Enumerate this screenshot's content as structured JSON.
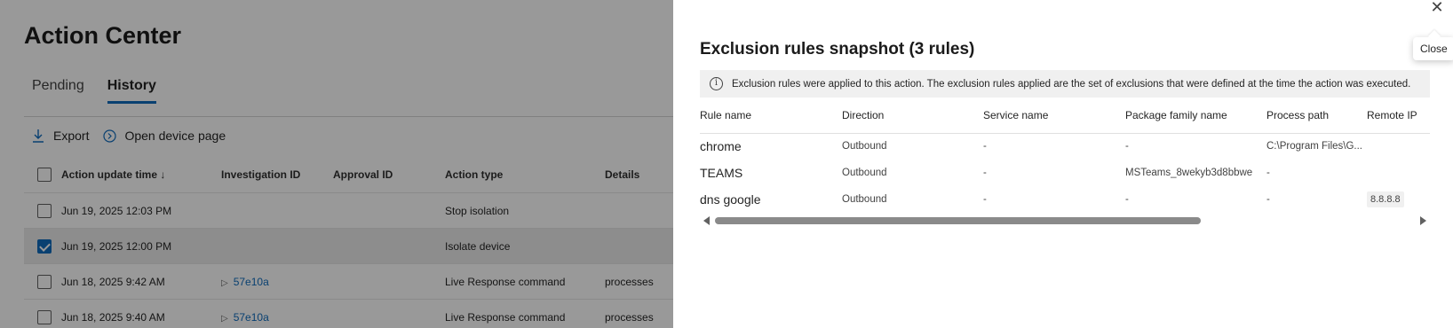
{
  "page": {
    "title": "Action Center",
    "tabs": [
      {
        "label": "Pending"
      },
      {
        "label": "History"
      }
    ],
    "toolbar": {
      "export_label": "Export",
      "open_device_label": "Open device page"
    },
    "grid": {
      "columns": [
        "Action update time ↓",
        "Investigation ID",
        "Approval ID",
        "Action type",
        "Details"
      ],
      "rows": [
        {
          "time": "Jun 19, 2025 12:03 PM",
          "investigation": "",
          "action": "Stop isolation",
          "details": ""
        },
        {
          "time": "Jun 19, 2025 12:00 PM",
          "investigation": "",
          "action": "Isolate device",
          "details": ""
        },
        {
          "time": "Jun 18, 2025 9:42 AM",
          "investigation": "57e10a",
          "action": "Live Response command",
          "details": "processes"
        },
        {
          "time": "Jun 18, 2025 9:40 AM",
          "investigation": "57e10a",
          "action": "Live Response command",
          "details": "processes"
        }
      ]
    }
  },
  "panel": {
    "title": "Exclusion rules snapshot (3 rules)",
    "close_tooltip": "Close",
    "info_text": "Exclusion rules were applied to this action. The exclusion rules applied are the set of exclusions that were defined at the time the action was executed.",
    "columns": [
      "Rule name",
      "Direction",
      "Service name",
      "Package family name",
      "Process path",
      "Remote IP"
    ],
    "rules": [
      {
        "name": "chrome",
        "direction": "Outbound",
        "service": "-",
        "package": "-",
        "path": "C:\\Program Files\\G...",
        "remote_ip": ""
      },
      {
        "name": "TEAMS",
        "direction": "Outbound",
        "service": "-",
        "package": "MSTeams_8wekyb3d8bbwe",
        "path": "-",
        "remote_ip": ""
      },
      {
        "name": "dns google",
        "direction": "Outbound",
        "service": "-",
        "package": "-",
        "path": "-",
        "remote_ip": "8.8.8.8"
      }
    ]
  },
  "icons": {
    "export": "download-icon",
    "open_device": "chevron-circle-icon",
    "info": "info-icon",
    "close": "close-icon"
  },
  "colors": {
    "accent": "#0f6cbd",
    "overlay": "rgba(0,0,0,0.40)"
  }
}
